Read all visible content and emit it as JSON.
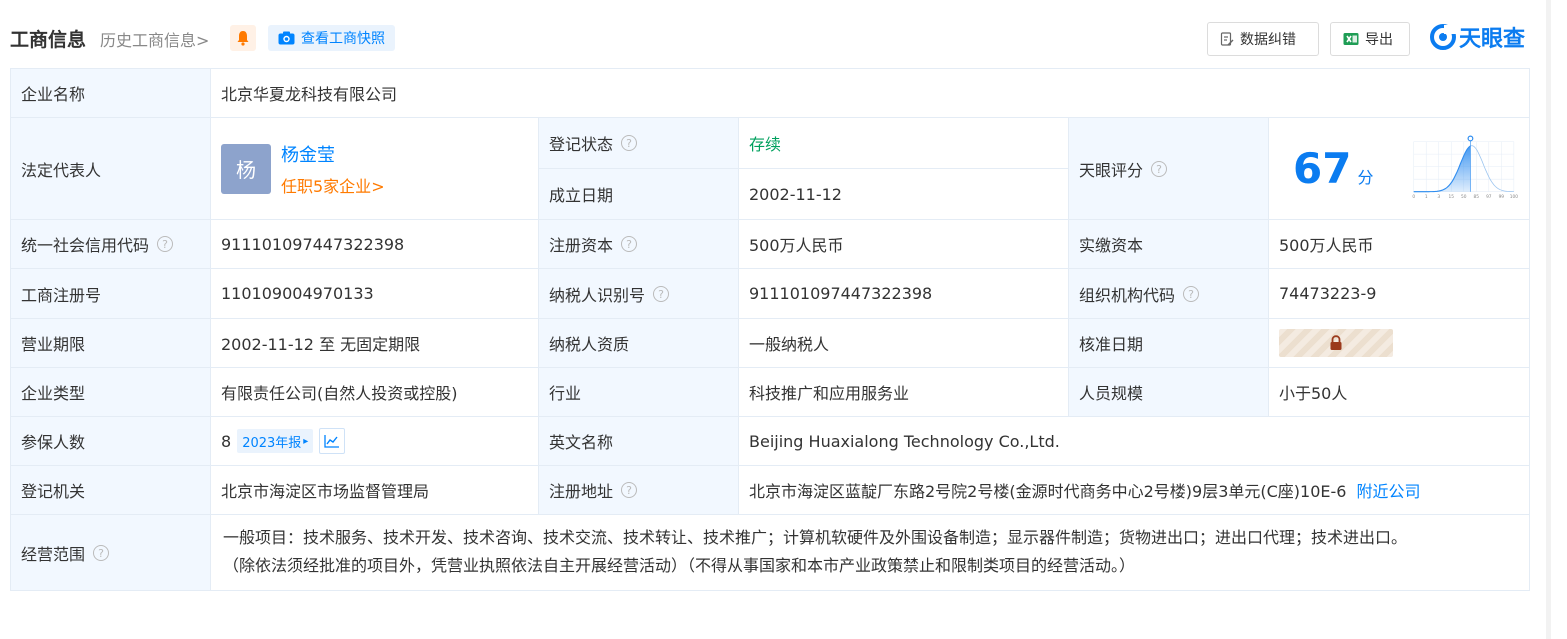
{
  "header": {
    "title": "工商信息",
    "history_link": "历史工商信息",
    "history_chevron": ">",
    "snapshot_button": "查看工商快照",
    "fix_button": "数据纠错",
    "export_button": "导出",
    "logo_text": "天眼查",
    "accent_color": "#0084ff"
  },
  "rows": {
    "company_name_label": "企业名称",
    "company_name": "北京华夏龙科技有限公司",
    "legal_rep_label": "法定代表人",
    "legal_rep_avatar": "杨",
    "legal_rep_name": "杨金莹",
    "legal_rep_roles": "任职5家企业",
    "legal_rep_chevron": ">",
    "reg_status_label": "登记状态",
    "reg_status": "存续",
    "est_date_label": "成立日期",
    "est_date": "2002-11-12",
    "tianyan_label": "天眼评分",
    "tianyan_score": "67",
    "tianyan_unit": "分",
    "credit_code_label": "统一社会信用代码",
    "credit_code": "911101097447322398",
    "reg_capital_label": "注册资本",
    "reg_capital": "500万人民币",
    "paid_capital_label": "实缴资本",
    "paid_capital": "500万人民币",
    "biz_reg_no_label": "工商注册号",
    "biz_reg_no": "110109004970133",
    "taxpayer_id_label": "纳税人识别号",
    "taxpayer_id": "911101097447322398",
    "org_code_label": "组织机构代码",
    "org_code": "74473223-9",
    "term_label": "营业期限",
    "term": "2002-11-12 至 无固定期限",
    "taxpayer_type_label": "纳税人资质",
    "taxpayer_type": "一般纳税人",
    "approval_date_label": "核准日期",
    "company_type_label": "企业类型",
    "company_type": "有限责任公司(自然人投资或控股)",
    "industry_label": "行业",
    "industry": "科技推广和应用服务业",
    "staff_size_label": "人员规模",
    "staff_size": "小于50人",
    "insured_label": "参保人数",
    "insured": "8",
    "insured_year_tag": "2023年报",
    "insured_year_arrow": "▸",
    "english_name_label": "英文名称",
    "english_name": "Beijing Huaxialong Technology Co.,Ltd.",
    "reg_authority_label": "登记机关",
    "reg_authority": "北京市海淀区市场监督管理局",
    "reg_address_label": "注册地址",
    "reg_address": "北京市海淀区蓝靛厂东路2号院2号楼(金源时代商务中心2号楼)9层3单元(C座)10E-6",
    "nearby_link": "附近公司",
    "scope_label": "经营范围",
    "scope_line1": "一般项目：技术服务、技术开发、技术咨询、技术交流、技术转让、技术推广；计算机软硬件及外围设备制造；显示器件制造；货物进出口；进出口代理；技术进出口。",
    "scope_line2": "（除依法须经批准的项目外，凭营业执照依法自主开展经营活动）（不得从事国家和本市产业政策禁止和限制类项目的经营活动。）",
    "help_glyph": "?"
  },
  "chart_data": {
    "type": "area",
    "title": "",
    "x_ticks": [
      "0",
      "1",
      "3",
      "15",
      "50",
      "85",
      "97",
      "99",
      "100"
    ],
    "marker_x": "67",
    "color": "#2f8df0"
  }
}
